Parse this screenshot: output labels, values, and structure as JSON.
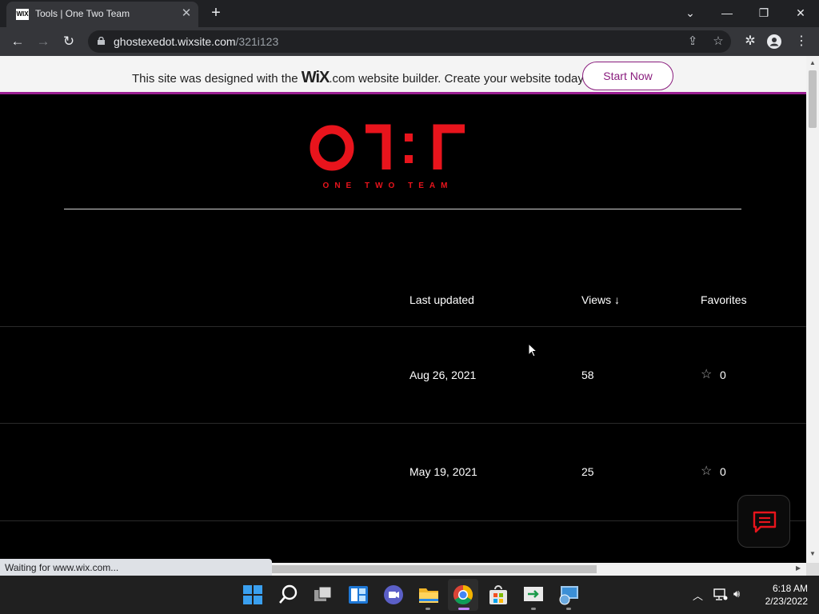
{
  "browser": {
    "tab_title": "Tools | One Two Team",
    "favicon_text": "WIX",
    "url_host": "ghostexedot.wixsite.com",
    "url_path": "/321i123",
    "status_text": "Waiting for www.wix.com..."
  },
  "wix_banner": {
    "text_before": "This site was designed with the ",
    "logo": "WiX",
    "text_after": ".com website builder. Create your website today.",
    "cta": "Start Now"
  },
  "site": {
    "logo_text": "ONE TWO TEAM"
  },
  "table": {
    "columns": {
      "updated": "Last updated",
      "views": "Views",
      "views_sort": "↓",
      "favorites": "Favorites"
    },
    "rows": [
      {
        "updated": "Aug 26, 2021",
        "views": "58",
        "favorites": "0"
      },
      {
        "updated": "May 19, 2021",
        "views": "25",
        "favorites": "0"
      }
    ]
  },
  "taskbar": {
    "time": "6:18 AM",
    "date": "2/23/2022"
  },
  "colors": {
    "accent": "#9a1e92",
    "logo_red": "#e8141c"
  }
}
